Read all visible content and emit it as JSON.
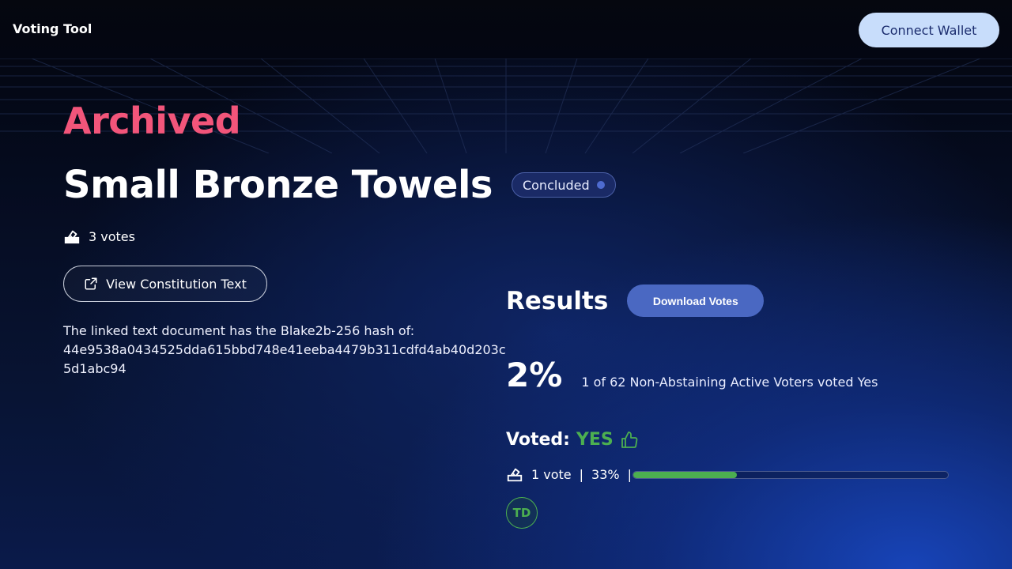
{
  "header": {
    "logo": "Voting Tool",
    "connect_label": "Connect Wallet"
  },
  "proposal": {
    "state": "Archived",
    "title": "Small Bronze Towels",
    "status": "Concluded",
    "votes_count": "3 votes",
    "view_label": "View Constitution Text",
    "hash_intro": "The linked text document has the Blake2b-256 hash of:",
    "hash_value": "44e9538a0434525dda615bbd748e41eeba4479b311cdfd4ab40d203c5d1abc94"
  },
  "results": {
    "title": "Results",
    "download_label": "Download Votes",
    "percent": "2%",
    "summary": "1 of 62 Non-Abstaining Active Voters voted Yes",
    "voted_label": "Voted:",
    "voted_value": "YES",
    "tally_votes": "1 vote",
    "tally_pct": "33%",
    "progress_fraction": 0.33,
    "voter_initials": "TD"
  },
  "colors": {
    "archived": "#f2557a",
    "yes": "#4caf50",
    "accent": "#4a68c2",
    "connect_bg": "#c8ddfb"
  },
  "icons": {
    "ballot": "ballot-box-icon",
    "external": "external-link-icon",
    "thumb": "thumbs-up-icon",
    "status_dot": "status-dot-icon"
  }
}
